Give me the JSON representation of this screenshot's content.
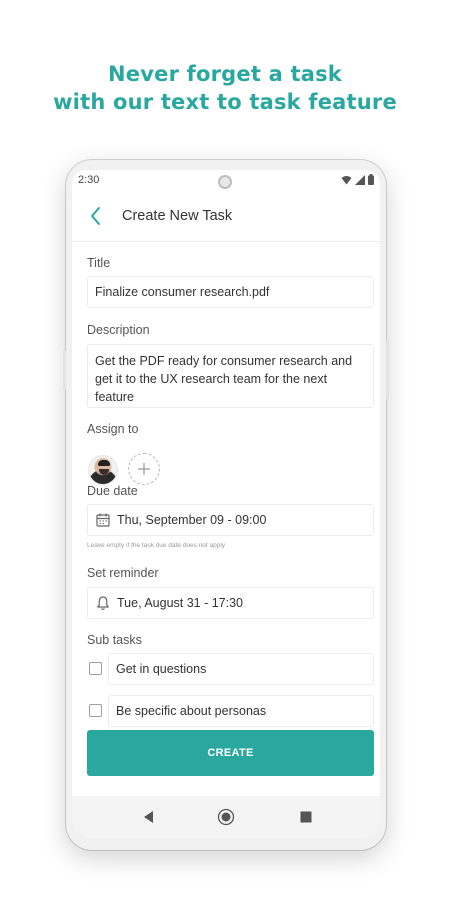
{
  "promo": {
    "line1": "Never forget a task",
    "line2": "with our text to task feature",
    "color": "#2aa8a0"
  },
  "status_bar": {
    "time": "2:30",
    "icons": [
      "wifi-icon",
      "cellular-icon",
      "battery-icon"
    ]
  },
  "app_bar": {
    "back_icon": "chevron-left-icon",
    "title": "Create New Task"
  },
  "form": {
    "title_label": "Title",
    "title_value": "Finalize consumer research.pdf",
    "description_label": "Description",
    "description_value": "Get the PDF ready for consumer research and get it to the UX research team for the next feature",
    "assign_label": "Assign to",
    "add_assignee_icon": "plus-icon",
    "due_date_label": "Due date",
    "due_date_value": "Thu, September 09 - 09:00",
    "due_date_icon": "calendar-icon",
    "due_date_hint": "Leave empty if the task due date does not apply",
    "reminder_label": "Set reminder",
    "reminder_value": "Tue, August 31 - 17:30",
    "reminder_icon": "bell-icon",
    "subtasks_label": "Sub tasks",
    "subtasks": [
      {
        "text": "Get in questions",
        "checked": false
      },
      {
        "text": "Be specific about personas",
        "checked": false
      }
    ],
    "create_label": "CREATE"
  },
  "nav_bar": {
    "items": [
      "back-triangle-icon",
      "home-circle-icon",
      "recents-square-icon"
    ]
  },
  "accent_color": "#2aa8a0"
}
